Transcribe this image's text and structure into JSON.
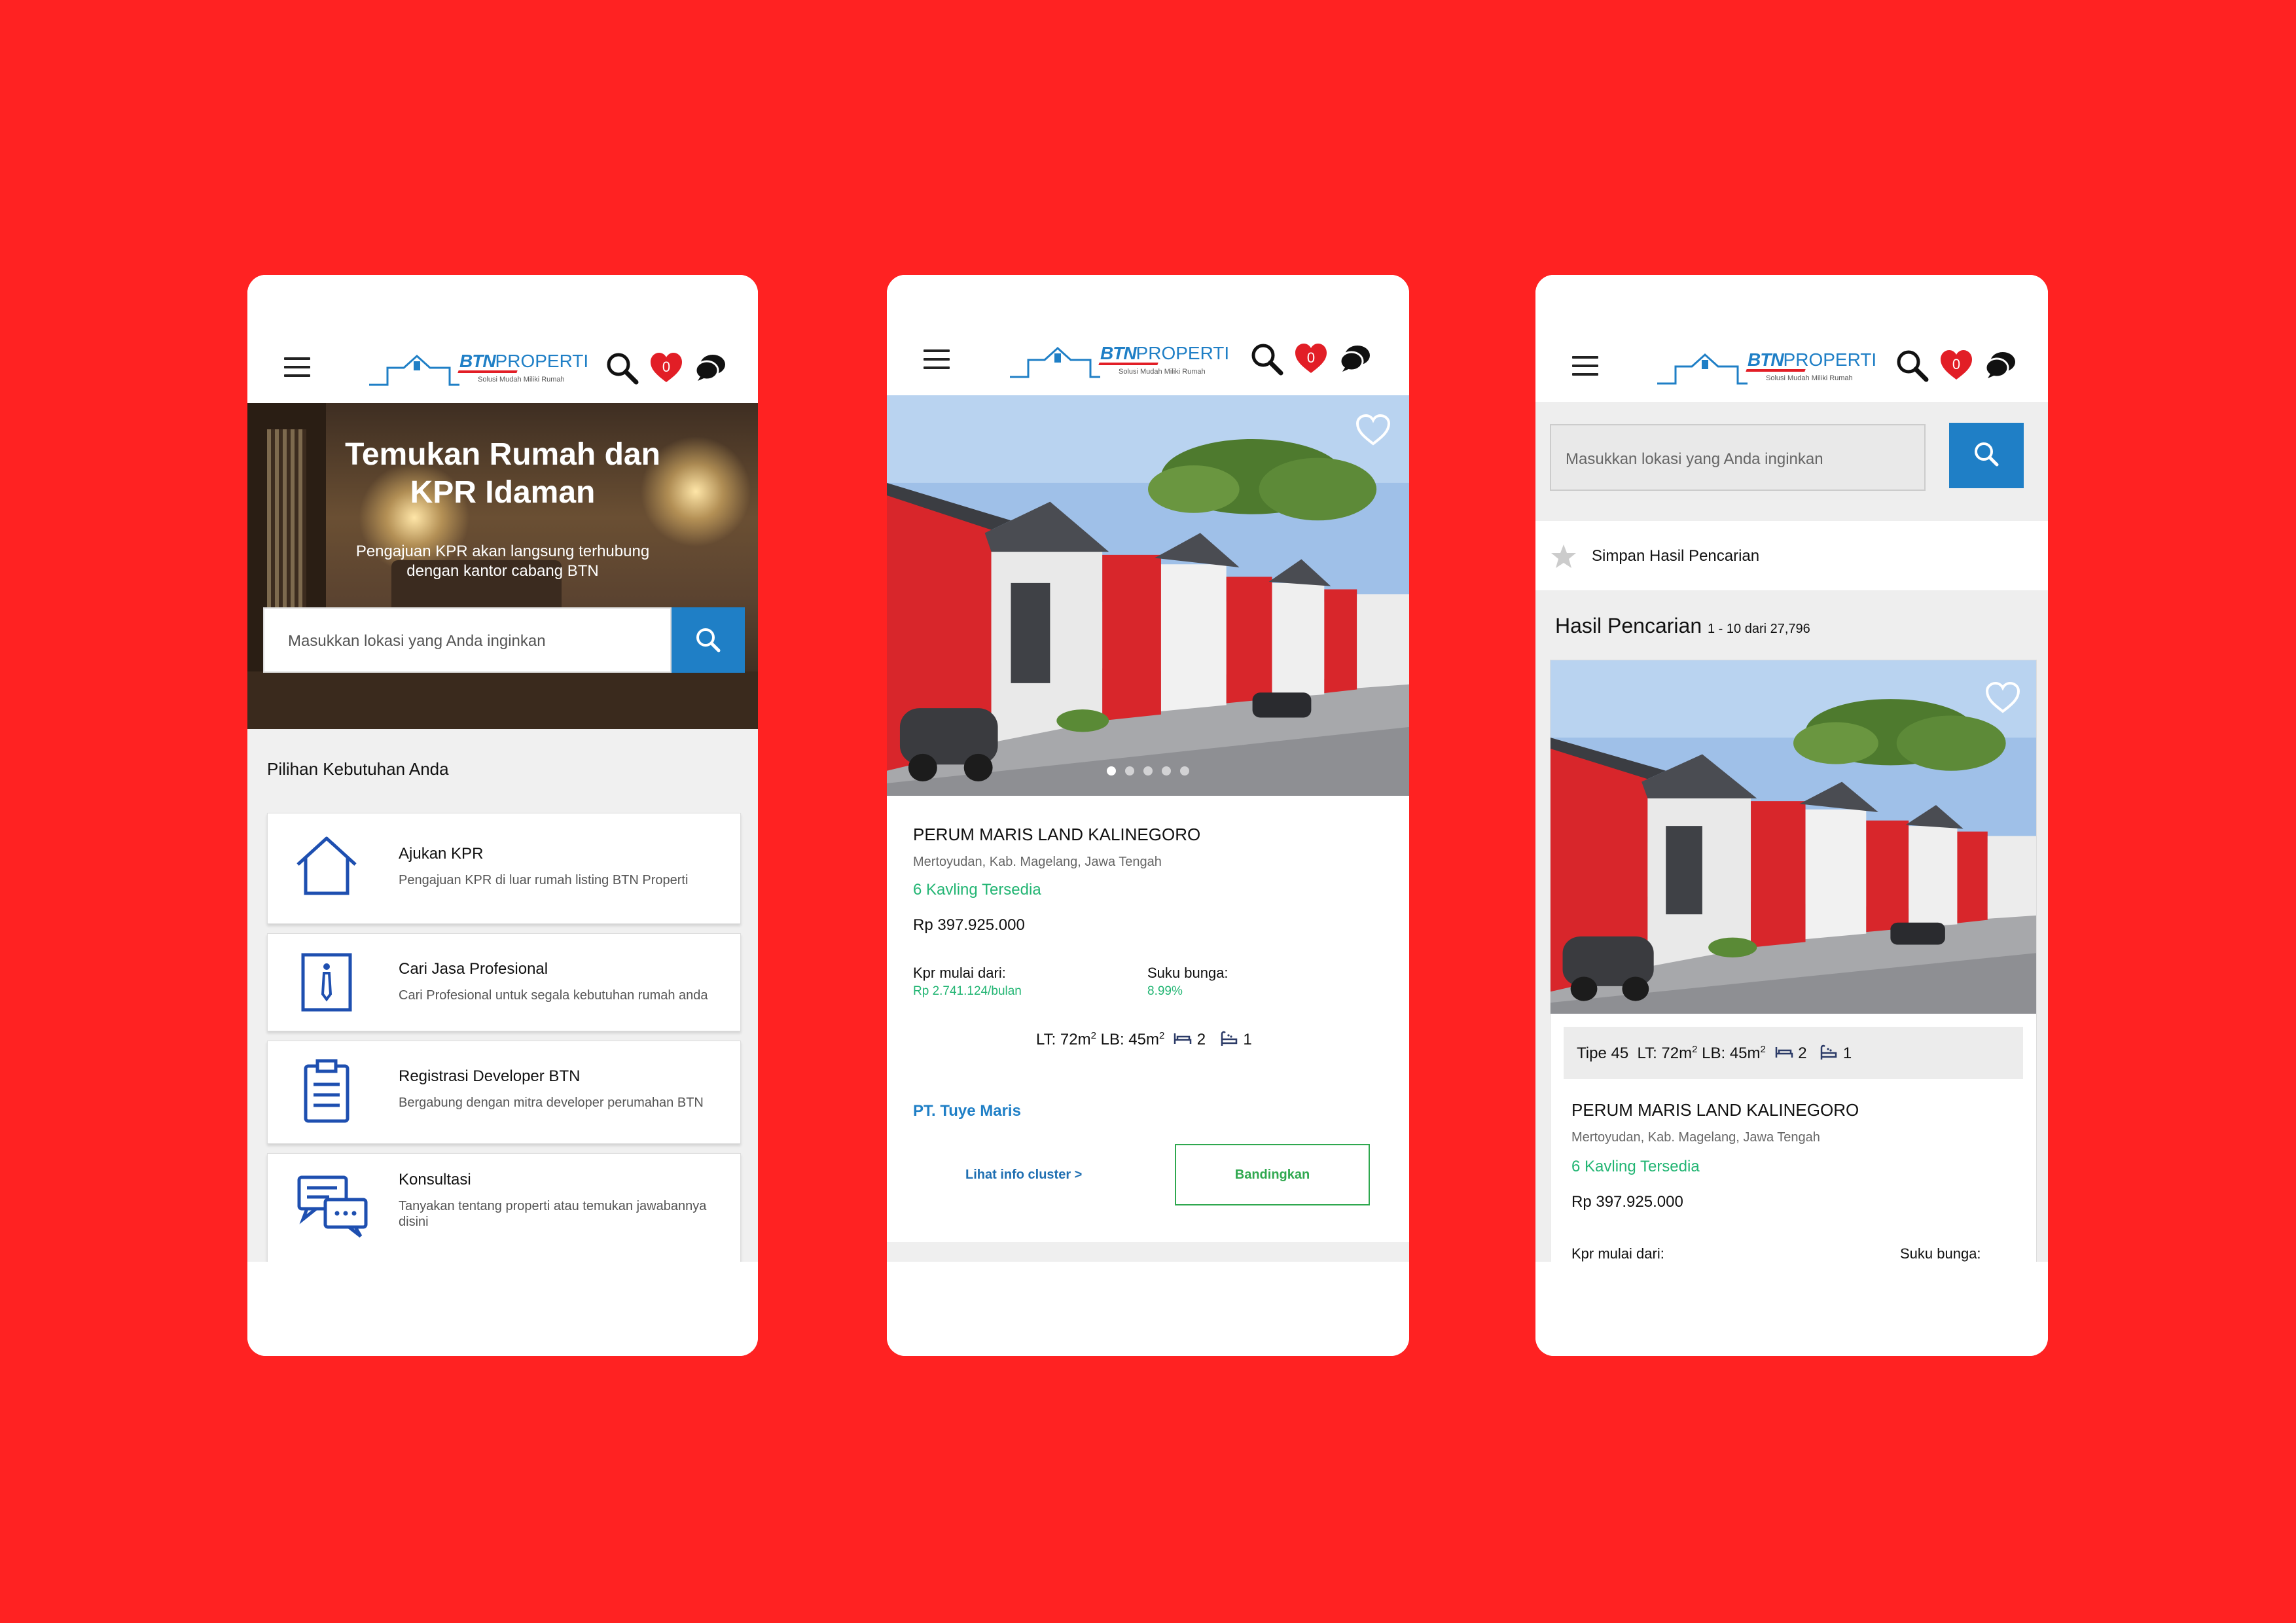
{
  "brand": {
    "logo_bold": "BTN",
    "logo_thin": "PROPERTI",
    "tagline": "Solusi Mudah Miliki Rumah",
    "primary_color": "#1f7fc6",
    "accent_color": "#e21e26",
    "background_color": "#ff2222",
    "green_color": "#22b573"
  },
  "header": {
    "menu_icon": "hamburger-menu-icon",
    "search_icon": "search-icon",
    "favorites_icon": "heart-icon",
    "favorites_count": "0",
    "chat_icon": "chat-icon"
  },
  "home": {
    "hero_title_line1": "Temukan Rumah dan",
    "hero_title_line2": "KPR Idaman",
    "hero_sub_line1": "Pengajuan KPR akan langsung terhubung",
    "hero_sub_line2": "dengan kantor cabang BTN",
    "search_placeholder": "Masukkan lokasi yang Anda inginkan",
    "section_title": "Pilihan Kebutuhan Anda",
    "cards": [
      {
        "icon": "house-icon",
        "title": "Ajukan KPR",
        "desc": "Pengajuan KPR di luar rumah listing BTN Properti"
      },
      {
        "icon": "tie-icon",
        "title": "Cari Jasa Profesional",
        "desc": "Cari Profesional untuk segala kebutuhan rumah anda"
      },
      {
        "icon": "clipboard-icon",
        "title": "Registrasi Developer BTN",
        "desc": "Bergabung dengan mitra developer perumahan BTN"
      },
      {
        "icon": "chat-bubbles-icon",
        "title": "Konsultasi",
        "desc": "Tanyakan tentang properti atau temukan jawabannya disini"
      }
    ]
  },
  "detail": {
    "name": "PERUM MARIS LAND KALINEGORO",
    "location": "Mertoyudan, Kab. Magelang, Jawa Tengah",
    "availability": "6 Kavling Tersedia",
    "price": "Rp 397.925.000",
    "kpr_label": "Kpr mulai dari:",
    "kpr_value": "Rp 2.741.124/bulan",
    "rate_label": "Suku bunga:",
    "rate_value": "8.99%",
    "lt": "LT: 72m",
    "lb": "LB: 45m",
    "sq_sup": "2",
    "bedrooms": "2",
    "bathrooms": "1",
    "developer": "PT. Tuye Maris",
    "cluster_link": "Lihat info cluster >",
    "compare_button": "Bandingkan",
    "carousel_total": 5,
    "carousel_active": 1
  },
  "results": {
    "search_placeholder": "Masukkan lokasi yang Anda inginkan",
    "save_label": "Simpan Hasil Pencarian",
    "title": "Hasil Pencarian",
    "count": "1 - 10 dari 27,796",
    "type": "Tipe 45",
    "lt": "LT: 72m",
    "lb": "LB: 45m",
    "sq_sup": "2",
    "bedrooms": "2",
    "bathrooms": "1",
    "name": "PERUM MARIS LAND KALINEGORO",
    "location": "Mertoyudan, Kab. Magelang, Jawa Tengah",
    "availability": "6 Kavling Tersedia",
    "price": "Rp 397.925.000",
    "kpr_label": "Kpr mulai dari:",
    "rate_label": "Suku bunga:"
  }
}
